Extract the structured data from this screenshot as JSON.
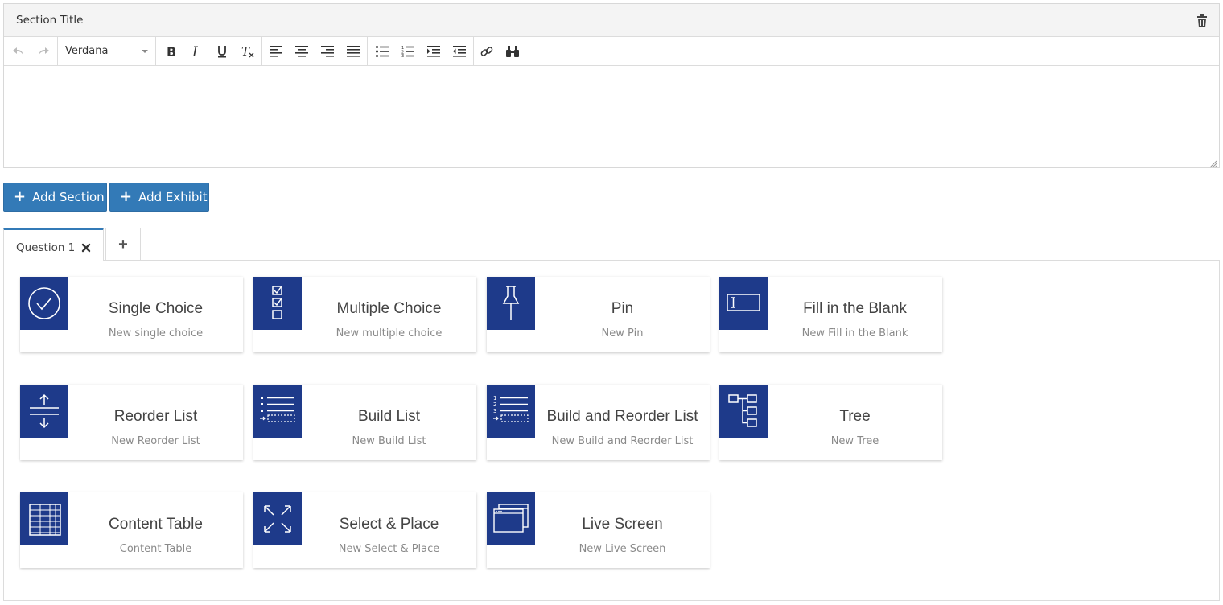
{
  "editor": {
    "section_title": "Section Title",
    "font_family_value": "Verdana"
  },
  "actions": {
    "add_section": "Add Section",
    "add_exhibit": "Add Exhibit"
  },
  "tabs": [
    {
      "label": "Question 1"
    }
  ],
  "colors": {
    "primary": "#337ab7",
    "tile_icon_bg": "#1e3a8a"
  },
  "question_types": [
    {
      "title": "Single Choice",
      "subtitle": "New single choice",
      "icon": "check-circle-icon"
    },
    {
      "title": "Multiple Choice",
      "subtitle": "New multiple choice",
      "icon": "checkbox-list-icon"
    },
    {
      "title": "Pin",
      "subtitle": "New Pin",
      "icon": "pushpin-icon"
    },
    {
      "title": "Fill in the Blank",
      "subtitle": "New Fill in the Blank",
      "icon": "text-field-icon"
    },
    {
      "title": "Reorder List",
      "subtitle": "New Reorder List",
      "icon": "reorder-arrows-icon"
    },
    {
      "title": "Build List",
      "subtitle": "New Build List",
      "icon": "build-list-icon"
    },
    {
      "title": "Build and Reorder List",
      "subtitle": "New Build and Reorder List",
      "icon": "numbered-build-list-icon"
    },
    {
      "title": "Tree",
      "subtitle": "New Tree",
      "icon": "tree-icon"
    },
    {
      "title": "Content Table",
      "subtitle": "Content Table",
      "icon": "table-icon"
    },
    {
      "title": "Select & Place",
      "subtitle": "New Select & Place",
      "icon": "expand-arrows-icon"
    },
    {
      "title": "Live Screen",
      "subtitle": "New Live Screen",
      "icon": "windows-icon"
    }
  ]
}
